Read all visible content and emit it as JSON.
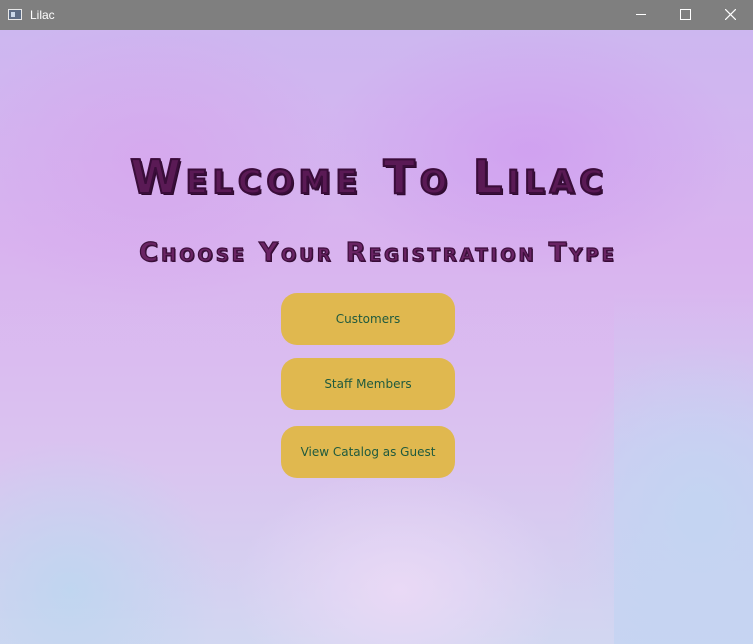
{
  "window": {
    "title": "Lilac",
    "icon": "app-window-icon",
    "controls": {
      "minimize_icon": "minimize-icon",
      "maximize_icon": "maximize-icon",
      "close_icon": "close-icon"
    }
  },
  "main": {
    "heading": "Welcome To Lilac",
    "subheading": "Choose Your Registration Type",
    "buttons": [
      {
        "label": "Customers"
      },
      {
        "label": "Staff Members"
      },
      {
        "label": "View Catalog as Guest"
      }
    ]
  },
  "colors": {
    "titlebar": "#7f7f7f",
    "button_fill": "#e0b84f",
    "button_text": "#1f5a3e",
    "heading_fill": "#5a1a55",
    "heading_outline": "#3a0d3a",
    "background_lilac": "#d9b3ef"
  }
}
